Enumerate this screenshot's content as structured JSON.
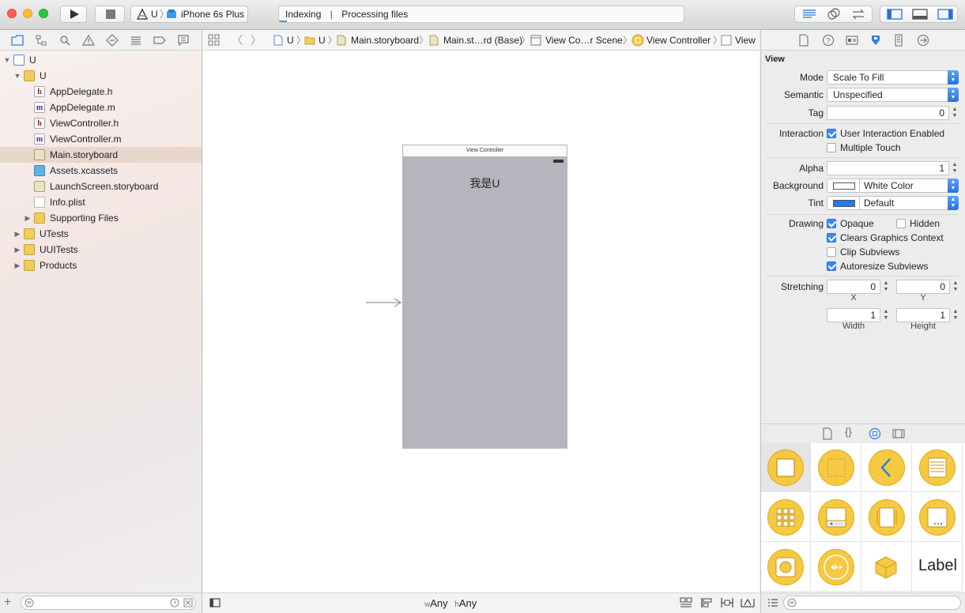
{
  "toolbar": {
    "scheme": "U",
    "device": "iPhone 6s Plus",
    "activity_status": "Indexing",
    "activity_detail": "Processing files",
    "progress": 0.02
  },
  "navigator": {
    "items": [
      {
        "label": "U",
        "kind": "project",
        "icon": "project-file-icon",
        "level": 0,
        "disclosure": "open"
      },
      {
        "label": "U",
        "kind": "folder",
        "icon": "folder-icon",
        "level": 1,
        "disclosure": "open"
      },
      {
        "label": "AppDelegate.h",
        "kind": "header",
        "icon": "header-file-icon",
        "level": 2
      },
      {
        "label": "AppDelegate.m",
        "kind": "impl",
        "icon": "implementation-file-icon",
        "level": 2
      },
      {
        "label": "ViewController.h",
        "kind": "header",
        "icon": "header-file-icon",
        "level": 2
      },
      {
        "label": "ViewController.m",
        "kind": "impl",
        "icon": "implementation-file-icon",
        "level": 2
      },
      {
        "label": "Main.storyboard",
        "kind": "storyboard",
        "icon": "storyboard-file-icon",
        "level": 2,
        "selected": true
      },
      {
        "label": "Assets.xcassets",
        "kind": "assets",
        "icon": "asset-catalog-icon",
        "level": 2
      },
      {
        "label": "LaunchScreen.storyboard",
        "kind": "storyboard",
        "icon": "storyboard-file-icon",
        "level": 2
      },
      {
        "label": "Info.plist",
        "kind": "plist",
        "icon": "plist-file-icon",
        "level": 2
      },
      {
        "label": "Supporting Files",
        "kind": "folder",
        "icon": "folder-icon",
        "level": 2,
        "disclosure": "closed"
      },
      {
        "label": "UTests",
        "kind": "folder",
        "icon": "folder-icon",
        "level": 1,
        "disclosure": "closed"
      },
      {
        "label": "UUITests",
        "kind": "folder",
        "icon": "folder-icon",
        "level": 1,
        "disclosure": "closed"
      },
      {
        "label": "Products",
        "kind": "folder",
        "icon": "folder-icon",
        "level": 1,
        "disclosure": "closed"
      }
    ]
  },
  "jumpbar": {
    "crumbs": [
      "U",
      "U",
      "Main.storyboard",
      "Main.st…rd (Base)",
      "View Co…r Scene",
      "View Controller",
      "View"
    ]
  },
  "canvas": {
    "scene_title": "View Controller",
    "label_text": "我是U",
    "view_color": "#b5b5bd",
    "size_class_w_prefix": "w",
    "size_class_w": "Any",
    "size_class_h_prefix": "h",
    "size_class_h": "Any"
  },
  "inspector": {
    "section": "View",
    "mode_label": "Mode",
    "mode_value": "Scale To Fill",
    "semantic_label": "Semantic",
    "semantic_value": "Unspecified",
    "tag_label": "Tag",
    "tag_value": "0",
    "interaction_label": "Interaction",
    "user_interaction": {
      "label": "User Interaction Enabled",
      "checked": true
    },
    "multiple_touch": {
      "label": "Multiple Touch",
      "checked": false
    },
    "alpha_label": "Alpha",
    "alpha_value": "1",
    "background_label": "Background",
    "background_value": "White Color",
    "background_swatch": "#ffffff",
    "tint_label": "Tint",
    "tint_value": "Default",
    "tint_swatch": "#1b7cf5",
    "drawing_label": "Drawing",
    "opaque": {
      "label": "Opaque",
      "checked": true
    },
    "hidden": {
      "label": "Hidden",
      "checked": false
    },
    "clears_context": {
      "label": "Clears Graphics Context",
      "checked": true
    },
    "clip_subviews": {
      "label": "Clip Subviews",
      "checked": false
    },
    "autoresize": {
      "label": "Autoresize Subviews",
      "checked": true
    },
    "stretching_label": "Stretching",
    "stretch_x": "0",
    "stretch_y": "0",
    "stretch_width": "1",
    "stretch_height": "1",
    "x_caption": "X",
    "y_caption": "Y",
    "width_caption": "Width",
    "height_caption": "Height"
  },
  "library": {
    "items": [
      {
        "name": "view-object-icon"
      },
      {
        "name": "container-view-object-icon"
      },
      {
        "name": "navigation-back-object-icon"
      },
      {
        "name": "table-view-object-icon"
      },
      {
        "name": "collection-view-object-icon"
      },
      {
        "name": "tab-bar-object-icon"
      },
      {
        "name": "page-view-object-icon"
      },
      {
        "name": "split-view-object-icon"
      },
      {
        "name": "glkit-view-object-icon"
      },
      {
        "name": "av-player-object-icon"
      },
      {
        "name": "scene-kit-object-icon"
      },
      {
        "name": "label-object",
        "text": "Label"
      }
    ]
  },
  "colors": {
    "accent": "#3b8af5",
    "folder": "#f0cc5a",
    "library_circle": "#f5c942"
  }
}
